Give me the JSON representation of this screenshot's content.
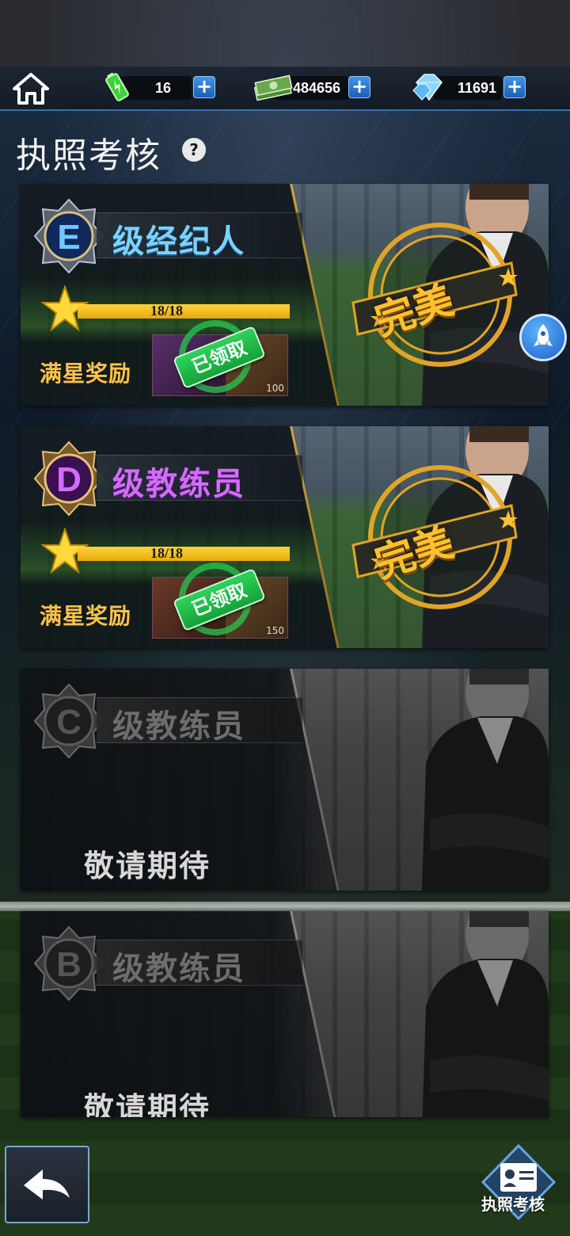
{
  "topbar": {
    "energy": "16",
    "cash": "484656",
    "diamonds": "11691",
    "plus": "+"
  },
  "page": {
    "title": "执照考核",
    "help": "?"
  },
  "cards": [
    {
      "badge_letter": "E",
      "title": "级经纪人",
      "progress_text": "18/18",
      "progress": 1.0,
      "reward_label": "满星奖励",
      "reward_amount": "100",
      "claimed_label": "已领取",
      "status": "完美"
    },
    {
      "badge_letter": "D",
      "title": "级教练员",
      "progress_text": "18/18",
      "progress": 1.0,
      "reward_label": "满星奖励",
      "reward_amount": "150",
      "claimed_label": "已领取",
      "status": "完美"
    },
    {
      "badge_letter": "C",
      "title": "级教练员",
      "coming_soon": "敬请期待"
    },
    {
      "badge_letter": "B",
      "title": "级教练员",
      "coming_soon": "敬请期待"
    }
  ],
  "bottom_nav": {
    "license_label": "执照考核"
  },
  "colors": {
    "accent_blue": "#3e95e8",
    "gold": "#ffc22e",
    "claimed_green": "#2ed35a",
    "e_blue": "#7ad3ff",
    "d_purple": "#d46bff"
  }
}
